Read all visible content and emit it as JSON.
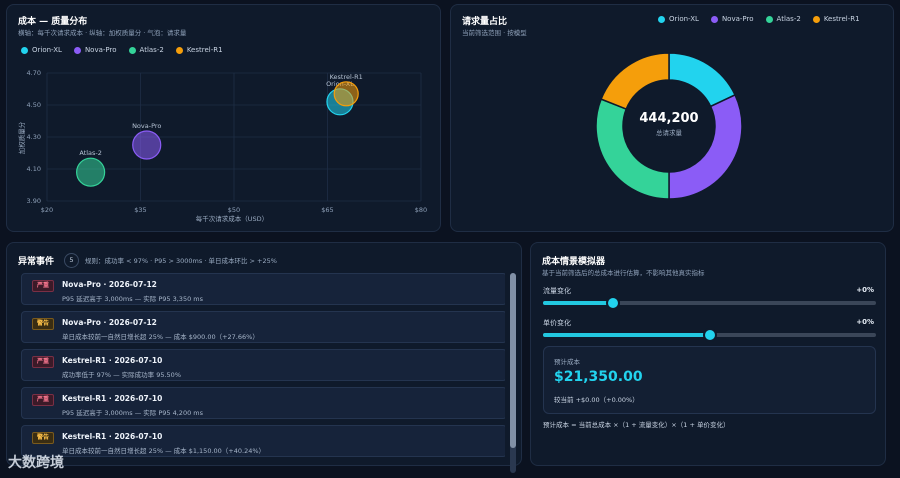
{
  "colors": {
    "orion": "#22d3ee",
    "nova": "#8b5cf6",
    "atlas": "#34d399",
    "kestrel": "#f59e0b"
  },
  "scatter": {
    "title": "成本 — 质量分布",
    "subtitle": "横轴：每千次请求成本 · 纵轴：加权质量分 · 气泡：请求量",
    "legend": [
      "Orion-XL",
      "Nova-Pro",
      "Atlas-2",
      "Kestrel-R1"
    ],
    "xlabel": "每千次请求成本（USD）",
    "ylabel": "加权质量分",
    "xticks": [
      "$20",
      "$35",
      "$50",
      "$65",
      "$80"
    ],
    "yticks": [
      "4.70",
      "4.50",
      "4.30",
      "4.10",
      "3.90"
    ]
  },
  "chart_data": [
    {
      "type": "scatter",
      "title": "成本 — 质量分布",
      "xlabel": "每千次请求成本（USD）",
      "ylabel": "加权质量分",
      "xlim": [
        20,
        80
      ],
      "ylim": [
        3.9,
        4.7
      ],
      "grid": true,
      "legend": "top-left",
      "series": [
        {
          "name": "Orion-XL",
          "x": 67,
          "y": 4.52,
          "r": 13
        },
        {
          "name": "Nova-Pro",
          "x": 36,
          "y": 4.25,
          "r": 14
        },
        {
          "name": "Atlas-2",
          "x": 27,
          "y": 4.08,
          "r": 14
        },
        {
          "name": "Kestrel-R1",
          "x": 68,
          "y": 4.57,
          "r": 12
        }
      ]
    },
    {
      "type": "pie",
      "title": "请求量占比",
      "legend": "top-right",
      "categories": [
        "Orion-XL",
        "Nova-Pro",
        "Atlas-2",
        "Kestrel-R1"
      ],
      "values": [
        18,
        32,
        31,
        19
      ]
    }
  ],
  "donut": {
    "title": "请求量占比",
    "subtitle": "当前筛选范围 · 按模型",
    "legend": [
      "Orion-XL",
      "Nova-Pro",
      "Atlas-2",
      "Kestrel-R1"
    ],
    "total": "444,200",
    "total_label": "总请求量"
  },
  "anomalies": {
    "title": "异常事件",
    "count": "5",
    "rule": "规则：成功率 < 97% · P95 > 3000ms · 单日成本环比 > +25%",
    "items": [
      {
        "severity": "严重",
        "title": "Nova-Pro · 2026-07-12",
        "desc": "P95 延迟高于 3,000ms — 实际 P95 3,350 ms",
        "level": "high"
      },
      {
        "severity": "警告",
        "title": "Nova-Pro · 2026-07-12",
        "desc": "单日成本较前一自然日增长超 25% — 成本 $900.00（+27.66%）",
        "level": "warn"
      },
      {
        "severity": "严重",
        "title": "Kestrel-R1 · 2026-07-10",
        "desc": "成功率低于 97% — 实际成功率 95.50%",
        "level": "high"
      },
      {
        "severity": "严重",
        "title": "Kestrel-R1 · 2026-07-10",
        "desc": "P95 延迟高于 3,000ms — 实际 P95 4,200 ms",
        "level": "high"
      },
      {
        "severity": "警告",
        "title": "Kestrel-R1 · 2026-07-10",
        "desc": "单日成本较前一自然日增长超 25% — 成本 $1,150.00（+40.24%）",
        "level": "warn"
      }
    ]
  },
  "simulator": {
    "title": "成本情景模拟器",
    "subtitle": "基于当前筛选后的总成本进行估算，不影响其他真实指标",
    "traffic_label": "流量变化",
    "traffic_value": "+0%",
    "traffic_fraction": 0.21,
    "price_label": "单价变化",
    "price_value": "+0%",
    "price_fraction": 0.5,
    "est_label": "预计成本",
    "est_value": "$21,350.00",
    "est_delta": "较当前 +$0.00（+0.00%）",
    "formula": "预计成本 = 当前总成本 ×（1 + 流量变化）×（1 + 单价变化）"
  },
  "watermark": "大数跨境"
}
